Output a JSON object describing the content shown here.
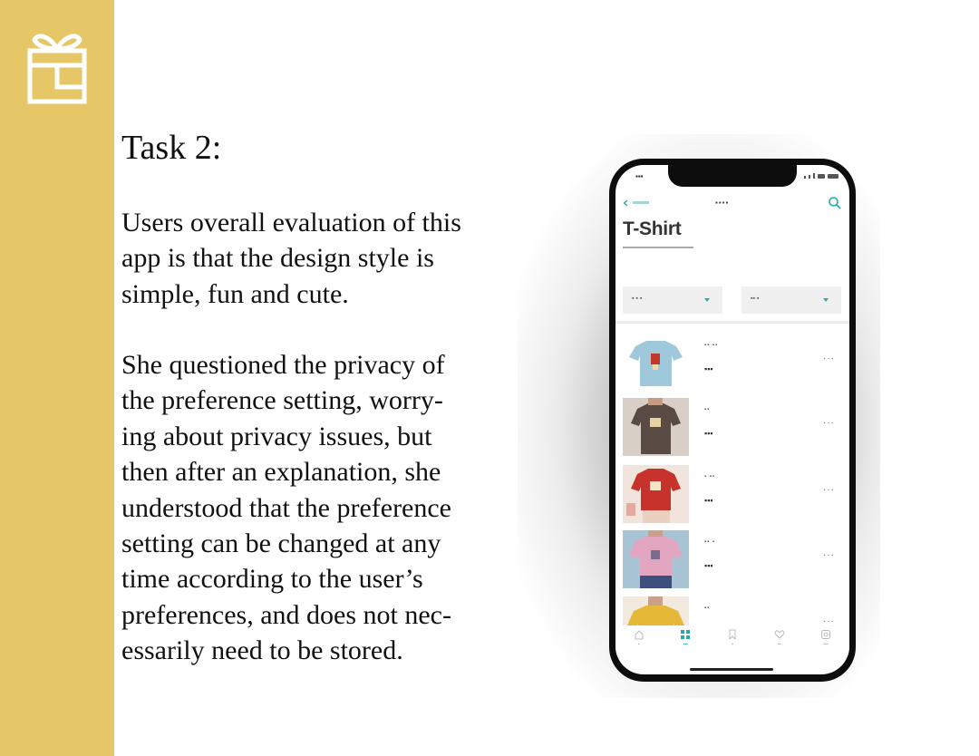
{
  "slide": {
    "task_title": "Task 2:",
    "paragraph1": [
      "Users overall evaluation of this",
      "app is that the design style is",
      "simple, fun and cute."
    ],
    "paragraph2": [
      "She questioned the privacy of",
      "the preference setting, worry-",
      "ing about privacy issues, but",
      "then after an explanation, she",
      "understood that the preference",
      "setting can be changed at any",
      "time according to the user’s",
      "preferences, and does not nec-",
      "essarily need to be stored."
    ]
  },
  "colors": {
    "sidebar": "#e6c767",
    "accent": "#2aa9ad"
  },
  "phone": {
    "page_title": "T-Shirt",
    "header_icons": [
      "back-chevron-icon",
      "search-icon"
    ],
    "filter_caret_icon": "caret-down-icon",
    "item_menu_icon": "more-dots-icon",
    "tab_icons": [
      "home-icon",
      "grid-icon",
      "bookmark-icon",
      "heart-icon",
      "settings-icon"
    ],
    "active_tab_index": 1,
    "products": [
      {
        "thumb_color": "#9fc9da",
        "garment_color": "#8fbfd3"
      },
      {
        "thumb_color": "#d8cfc6",
        "garment_color": "#5a4a44"
      },
      {
        "thumb_color": "#f0e4dc",
        "garment_color": "#c8322c"
      },
      {
        "thumb_color": "#a8c4d4",
        "garment_color": "#e2a6c0"
      },
      {
        "thumb_color": "#f2eadf",
        "garment_color": "#e6b838"
      }
    ]
  }
}
